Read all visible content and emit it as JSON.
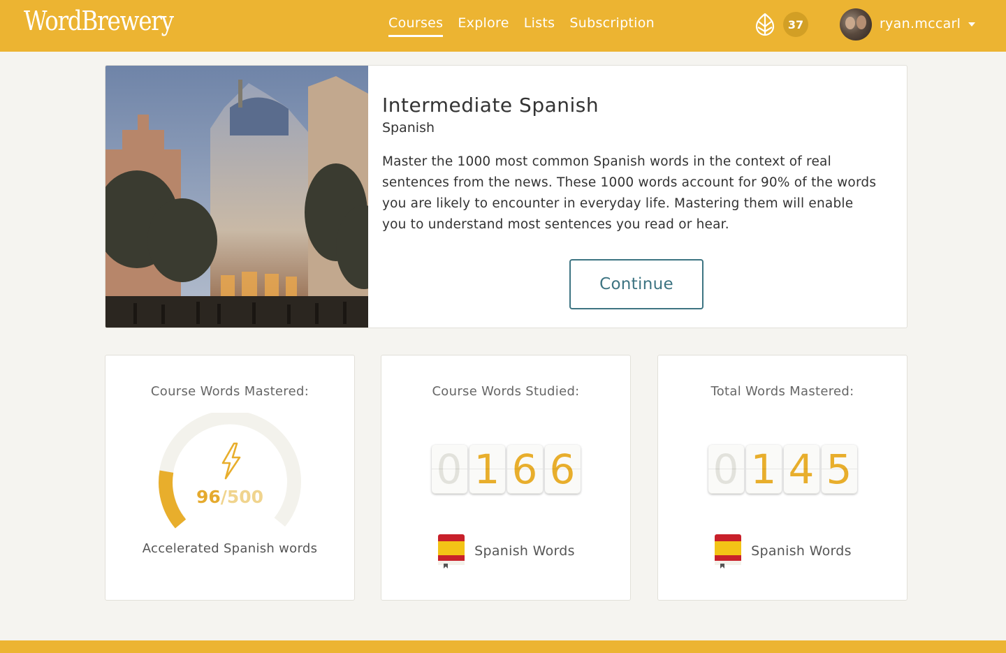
{
  "header": {
    "logo": "WordBrewery",
    "nav": [
      "Courses",
      "Explore",
      "Lists",
      "Subscription"
    ],
    "active_nav": "Courses",
    "hops_count": "37",
    "username": "ryan.mccarl",
    "brand_color": "#ecb432"
  },
  "course": {
    "title": "Intermediate Spanish",
    "language": "Spanish",
    "description": "Master the 1000 most common Spanish words in the context of real sentences from the news. These 1000 words account for 90% of the words you are likely to encounter in everyday life. Mastering them will enable you to understand most sentences you read or hear.",
    "button_label": "Continue",
    "button_color": "#3d7482"
  },
  "stats": {
    "mastered": {
      "title": "Course Words Mastered:",
      "value": "96",
      "total": "/500",
      "progress_fraction": 0.192,
      "icon": "lightning-icon",
      "footer": "Accelerated Spanish words"
    },
    "studied": {
      "title": "Course Words Studied:",
      "digits": [
        "0",
        "1",
        "6",
        "6"
      ],
      "list_icon": "spanish-book-icon",
      "list_label": "Spanish Words"
    },
    "total": {
      "title": "Total Words Mastered:",
      "digits": [
        "0",
        "1",
        "4",
        "5"
      ],
      "list_icon": "spanish-book-icon",
      "list_label": "Spanish Words"
    }
  }
}
